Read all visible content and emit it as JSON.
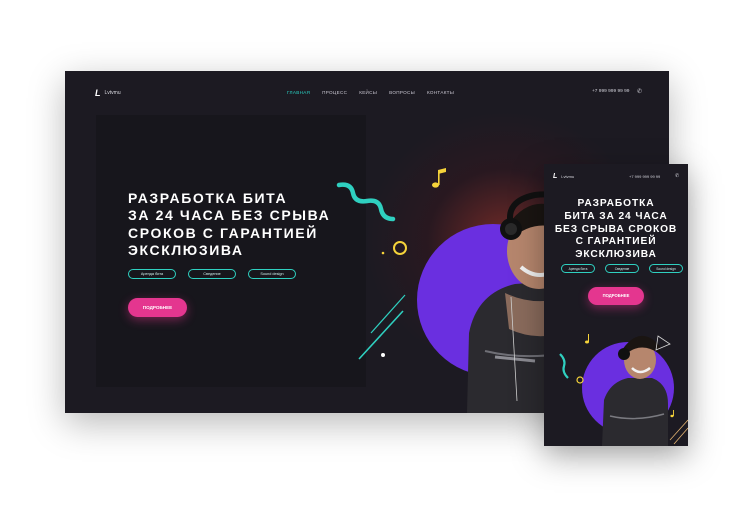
{
  "brand": {
    "name": "Lvtvmu"
  },
  "nav": [
    {
      "label": "Главная",
      "active": true
    },
    {
      "label": "Процесс",
      "active": false
    },
    {
      "label": "Кейсы",
      "active": false
    },
    {
      "label": "Вопросы",
      "active": false
    },
    {
      "label": "Контакты",
      "active": false
    }
  ],
  "contact": {
    "phone": "+7 999 999 99 99",
    "icon": "phone-icon"
  },
  "hero": {
    "title_lines": [
      "Разработка бита",
      "за 24 часа без срыва",
      "сроков с гарантией",
      "эксклюзива"
    ],
    "tags": [
      "Аренда бита",
      "Сведение",
      "Sound design"
    ],
    "cta": "Подробнее"
  },
  "mobile": {
    "title_lines": [
      "Разработка",
      "бита за 24 часа",
      "без срыва сроков",
      "с гарантией",
      "эксклюзива"
    ]
  },
  "colors": {
    "background": "#1c1a22",
    "accent_teal": "#2fd0c0",
    "accent_pink": "#e4368f",
    "accent_purple": "#6a2fe0",
    "accent_yellow": "#f5d33a"
  }
}
